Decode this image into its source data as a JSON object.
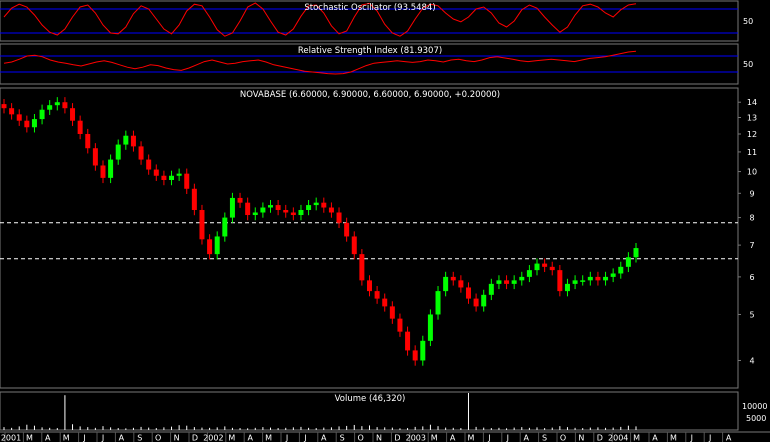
{
  "chart_data": [
    {
      "type": "line",
      "title": "Stochastic Oscillator (93.5484)",
      "ylim": [
        0,
        100
      ],
      "y_ticks": [
        "50"
      ],
      "reference_lines": [
        80,
        20
      ],
      "colors": {
        "line": "#ff0000",
        "reference": "#0000ff"
      },
      "values": [
        60,
        82,
        92,
        85,
        65,
        40,
        22,
        15,
        30,
        60,
        85,
        90,
        70,
        40,
        20,
        18,
        35,
        68,
        88,
        80,
        55,
        30,
        18,
        40,
        75,
        92,
        88,
        60,
        28,
        12,
        20,
        50,
        85,
        95,
        80,
        50,
        22,
        15,
        30,
        62,
        88,
        90,
        70,
        38,
        18,
        25,
        60,
        90,
        94,
        75,
        42,
        20,
        12,
        25,
        55,
        82,
        92,
        88,
        70,
        55,
        48,
        60,
        80,
        85,
        70,
        45,
        35,
        50,
        78,
        90,
        82,
        60,
        40,
        22,
        35,
        65,
        88,
        92,
        85,
        70,
        60,
        78,
        90,
        93
      ]
    },
    {
      "type": "line",
      "title": "Relative Strength Index (81.9307)",
      "ylim": [
        0,
        100
      ],
      "y_ticks": [
        "50"
      ],
      "reference_lines": [
        70,
        30
      ],
      "colors": {
        "line": "#ff0000",
        "reference": "#0000ff"
      },
      "values": [
        52,
        55,
        62,
        70,
        72,
        68,
        60,
        55,
        52,
        48,
        45,
        50,
        55,
        58,
        54,
        48,
        42,
        38,
        42,
        48,
        46,
        40,
        36,
        34,
        40,
        48,
        56,
        60,
        55,
        50,
        52,
        56,
        58,
        60,
        55,
        48,
        44,
        40,
        36,
        32,
        30,
        28,
        26,
        25,
        26,
        30,
        38,
        46,
        52,
        54,
        56,
        58,
        56,
        54,
        56,
        60,
        58,
        55,
        60,
        62,
        58,
        56,
        60,
        66,
        68,
        65,
        62,
        58,
        56,
        58,
        60,
        62,
        60,
        58,
        56,
        60,
        64,
        66,
        68,
        72,
        76,
        80,
        82
      ]
    },
    {
      "type": "candlestick",
      "title": "NOVABASE (6.60000, 6.90000, 6.60000, 6.90000, +0.20000)",
      "y_scale": "log",
      "ylim": [
        3.5,
        15
      ],
      "y_ticks": [
        14,
        13,
        12,
        11,
        10,
        9,
        8,
        7,
        6,
        5,
        4
      ],
      "x_ticks": [
        "2001",
        "M",
        "A",
        "M",
        "J",
        "J",
        "A",
        "S",
        "O",
        "N",
        "D",
        "2002",
        "M",
        "A",
        "M",
        "J",
        "J",
        "A",
        "S",
        "O",
        "N",
        "D",
        "2003",
        "M",
        "A",
        "M",
        "J",
        "J",
        "A",
        "S",
        "O",
        "N",
        "D",
        "2004",
        "M",
        "A",
        "M",
        "J",
        "J",
        "A"
      ],
      "horizontal_lines": [
        7.8,
        6.55
      ],
      "colors": {
        "up": "#00ff00",
        "down": "#ff0000",
        "dashed_line": "#ffffff"
      },
      "close": [
        13.6,
        13.2,
        12.8,
        12.4,
        12.9,
        13.5,
        13.8,
        14.0,
        13.6,
        12.8,
        12.0,
        11.2,
        10.3,
        9.7,
        10.6,
        11.4,
        11.9,
        11.3,
        10.6,
        10.1,
        9.8,
        9.6,
        9.8,
        9.9,
        9.2,
        8.3,
        7.2,
        6.7,
        7.3,
        8.0,
        8.8,
        8.6,
        8.1,
        8.2,
        8.4,
        8.5,
        8.3,
        8.2,
        8.1,
        8.3,
        8.5,
        8.6,
        8.4,
        8.2,
        7.8,
        7.3,
        6.7,
        5.9,
        5.6,
        5.4,
        5.2,
        4.9,
        4.6,
        4.2,
        4.0,
        4.4,
        5.0,
        5.6,
        6.0,
        5.9,
        5.7,
        5.4,
        5.2,
        5.5,
        5.8,
        5.9,
        5.8,
        5.9,
        6.0,
        6.2,
        6.4,
        6.3,
        6.2,
        5.6,
        5.8,
        5.9,
        5.9,
        6.0,
        5.9,
        6.0,
        6.1,
        6.3,
        6.6,
        6.9
      ]
    },
    {
      "type": "bar",
      "title": "Volume (46,320)",
      "y_ticks": [
        "10000",
        "5000"
      ],
      "colors": {
        "bar": "#ffffff"
      },
      "values": [
        1200,
        900,
        1500,
        2200,
        1800,
        1100,
        900,
        800,
        14500,
        2400,
        1500,
        1200,
        900,
        1600,
        1100,
        800,
        700,
        900,
        1300,
        1000,
        800,
        1100,
        1400,
        2000,
        1800,
        1200,
        1000,
        900,
        1100,
        1500,
        900,
        800,
        700,
        900,
        1200,
        1000,
        800,
        900,
        1100,
        1300,
        900,
        800,
        1000,
        1100,
        1500,
        1700,
        2100,
        1600,
        1900,
        1200,
        1100,
        1000,
        700,
        800,
        1300,
        1500,
        2200,
        1600,
        1000,
        900,
        800,
        46320,
        1300,
        1000,
        800,
        900,
        700,
        1000,
        1200,
        900,
        1100,
        800,
        1000,
        1600,
        1200,
        900,
        800,
        1000,
        1100,
        900,
        1000,
        1300,
        1800,
        1500
      ]
    }
  ]
}
